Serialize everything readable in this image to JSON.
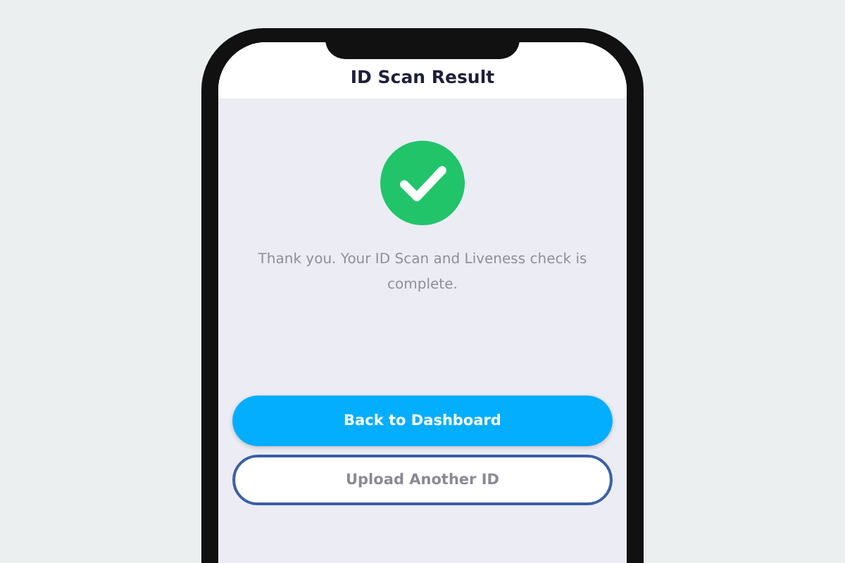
{
  "header": {
    "title": "ID Scan Result"
  },
  "status": {
    "kind": "success"
  },
  "message": "Thank you. Your ID Scan and Liveness check is complete.",
  "buttons": [
    {
      "label": "Back to Dashboard",
      "kind": "primary"
    },
    {
      "label": "Upload Another ID",
      "kind": "secondary"
    }
  ]
}
